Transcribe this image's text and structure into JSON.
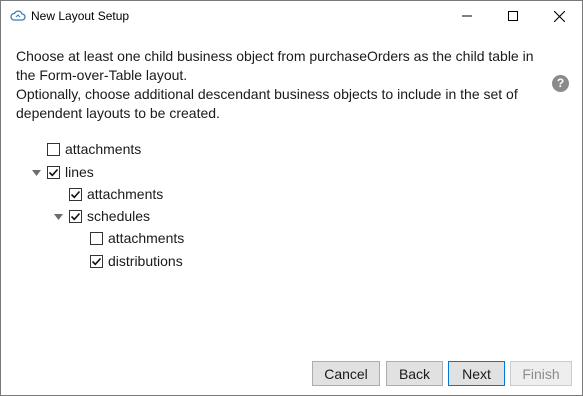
{
  "window": {
    "title": "New Layout Setup"
  },
  "instructions": {
    "line1": "Choose at least one child business object from purchaseOrders as the child table in",
    "line2": "the Form-over-Table layout.",
    "line3": "Optionally, choose additional descendant business objects to include in the set of",
    "line4": "dependent layouts to be created."
  },
  "tree": [
    {
      "label": "attachments",
      "checked": false
    },
    {
      "label": "lines",
      "checked": true,
      "expanded": true
    },
    {
      "label": "attachments",
      "checked": true
    },
    {
      "label": "schedules",
      "checked": true,
      "expanded": true
    },
    {
      "label": "attachments",
      "checked": false
    },
    {
      "label": "distributions",
      "checked": true
    }
  ],
  "buttons": {
    "cancel": "Cancel",
    "back": "Back",
    "next": "Next",
    "finish": "Finish"
  },
  "icons": {
    "app": "cloud-icon",
    "help": "question-icon",
    "help_glyph": "?"
  },
  "colors": {
    "accent": "#0078d7",
    "help_icon": "#8a8a8a",
    "disabled_text": "#8c8c8c"
  }
}
